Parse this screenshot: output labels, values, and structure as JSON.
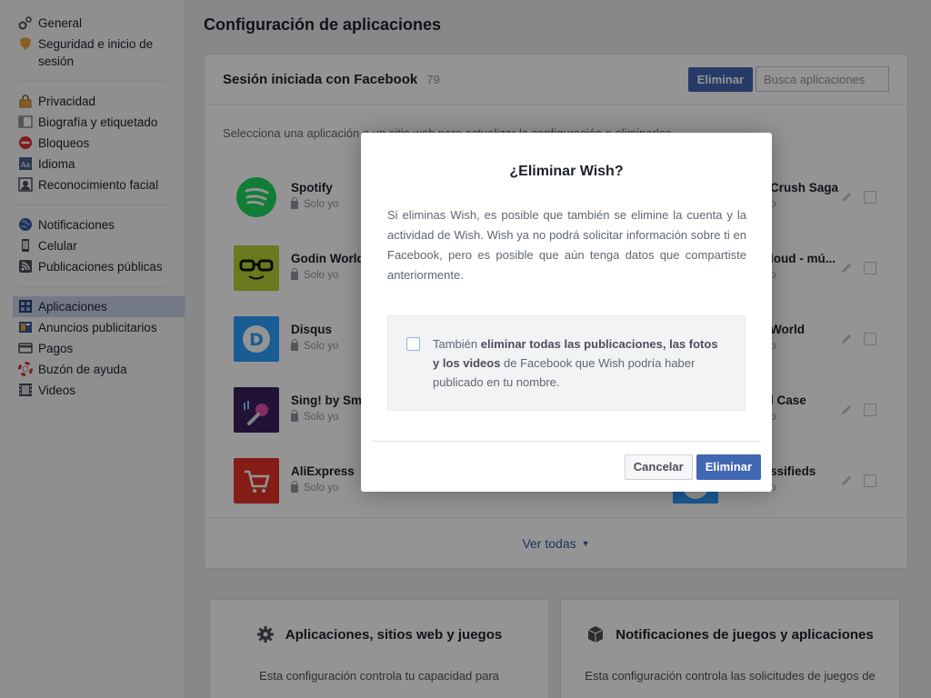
{
  "sidebar": {
    "groups": [
      [
        {
          "label": "General",
          "icon": "gear-icon"
        },
        {
          "label": "Seguridad e inicio de sesión",
          "icon": "shield-icon"
        }
      ],
      [
        {
          "label": "Privacidad",
          "icon": "lock-icon"
        },
        {
          "label": "Biografía y etiquetado",
          "icon": "timeline-icon"
        },
        {
          "label": "Bloqueos",
          "icon": "block-icon"
        },
        {
          "label": "Idioma",
          "icon": "language-icon"
        },
        {
          "label": "Reconocimiento facial",
          "icon": "face-icon"
        }
      ],
      [
        {
          "label": "Notificaciones",
          "icon": "globe-icon"
        },
        {
          "label": "Celular",
          "icon": "phone-icon"
        },
        {
          "label": "Publicaciones públicas",
          "icon": "rss-icon"
        }
      ],
      [
        {
          "label": "Aplicaciones",
          "icon": "apps-icon",
          "active": true
        },
        {
          "label": "Anuncios publicitarios",
          "icon": "ads-icon"
        },
        {
          "label": "Pagos",
          "icon": "card-icon"
        },
        {
          "label": "Buzón de ayuda",
          "icon": "lifebuoy-icon"
        },
        {
          "label": "Videos",
          "icon": "film-icon"
        }
      ]
    ]
  },
  "main": {
    "title": "Configuración de aplicaciones",
    "card": {
      "title": "Sesión iniciada con Facebook",
      "count": "79",
      "remove_label": "Eliminar",
      "search_placeholder": "Busca aplicaciones",
      "instructions": "Selecciona una aplicación o un sitio web para actualizar la configuración o eliminarlos.",
      "see_all": "Ver todas"
    },
    "apps_left": [
      {
        "name": "Spotify",
        "privacy": "Solo yo",
        "color": "#1ed760"
      },
      {
        "name": "Godin World",
        "privacy": "Solo yo",
        "color": "#b5d334"
      },
      {
        "name": "Disqus",
        "privacy": "Solo yo",
        "color": "#2e9fff"
      },
      {
        "name": "Sing! by Smule",
        "privacy": "Solo yo",
        "color": "#3b1f5e"
      },
      {
        "name": "AliExpress",
        "privacy": "Solo yo",
        "color": "#e43225"
      }
    ],
    "apps_right": [
      {
        "name": "Crush Saga",
        "privacy": "o"
      },
      {
        "name": "loud - mú...",
        "privacy": "o"
      },
      {
        "name": "World",
        "privacy": "o"
      },
      {
        "name": "l Case",
        "privacy": "o"
      },
      {
        "name": "ssifieds",
        "privacy": "o"
      }
    ],
    "lower": [
      {
        "title": "Aplicaciones, sitios web y juegos",
        "desc": "Esta configuración controla tu capacidad para",
        "icon": "gear-icon"
      },
      {
        "title": "Notificaciones de juegos y aplicaciones",
        "desc": "Esta configuración controla las solicitudes de juegos de",
        "icon": "cube-icon"
      }
    ]
  },
  "dialog": {
    "title": "¿Eliminar Wish?",
    "body": "Si eliminas Wish, es posible que también se elimine la cuenta y la actividad de Wish. Wish ya no podrá solicitar información sobre ti en Facebook, pero es posible que aún tenga datos que compartiste anteriormente.",
    "checkbox_pre": "También ",
    "checkbox_bold": "eliminar todas las publicaciones, las fotos y los videos",
    "checkbox_post": " de Facebook que Wish podría haber publicado en tu nombre.",
    "cancel_label": "Cancelar",
    "confirm_label": "Eliminar"
  }
}
